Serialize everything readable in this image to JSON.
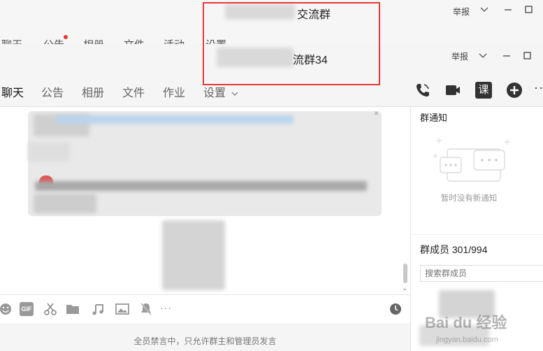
{
  "background_window": {
    "title_suffix": "交流群",
    "report_label": "举报",
    "tabs": [
      "聊天",
      "公告",
      "相册",
      "文件",
      "活动",
      "设置"
    ]
  },
  "front_window": {
    "title_suffix": "流群34",
    "report_label": "举报",
    "tabs": [
      {
        "label": "聊天",
        "active": true
      },
      {
        "label": "公告",
        "active": false
      },
      {
        "label": "相册",
        "active": false
      },
      {
        "label": "文件",
        "active": false
      },
      {
        "label": "作业",
        "active": false
      },
      {
        "label": "设置",
        "active": false
      }
    ],
    "more_label": "··",
    "lesson_label": "课"
  },
  "chat": {
    "close_glyph": "×",
    "mute_notice": "全员禁言中，只允许群主和管理员发言"
  },
  "input_toolbar": {
    "gif_label": "GIF",
    "more_label": "···"
  },
  "right_panel": {
    "notice_title": "群通知",
    "no_notice": "暂时没有新通知",
    "members_title": "群成员 301/994",
    "member_search_placeholder": "搜索群成员"
  },
  "watermark": {
    "text": "Bai du 经验",
    "url": "jingyan.baidu.com"
  },
  "colors": {
    "highlight": "#e53935",
    "unread_dot": "#e53935"
  }
}
